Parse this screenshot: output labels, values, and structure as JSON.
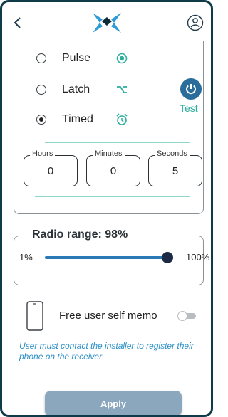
{
  "header": {
    "back_icon": "chevron-left-icon",
    "logo": "brand-logo",
    "profile_icon": "user-icon"
  },
  "modes": {
    "items": [
      {
        "label": "Pulse",
        "selected": false,
        "icon": "pulse-icon"
      },
      {
        "label": "Latch",
        "selected": false,
        "icon": "latch-icon"
      },
      {
        "label": "Timed",
        "selected": true,
        "icon": "alarm-clock-icon"
      }
    ],
    "test_label": "Test",
    "icon_color": "#2cae9e"
  },
  "timer": {
    "hours": {
      "label": "Hours",
      "value": "0"
    },
    "minutes": {
      "label": "Minutes",
      "value": "0"
    },
    "seconds": {
      "label": "Seconds",
      "value": "5"
    }
  },
  "radio_range": {
    "title": "Radio range: 98%",
    "min_label": "1%",
    "max_label": "100%",
    "value_percent": 98
  },
  "memo": {
    "label": "Free user self memo",
    "enabled": false,
    "note": "User must contact the installer to register their phone on the receiver"
  },
  "apply_label": "Apply",
  "colors": {
    "accent": "#2a7ab8",
    "teal": "#2cae9e",
    "frame": "#0f3a4a",
    "button": "#8aa7be"
  }
}
